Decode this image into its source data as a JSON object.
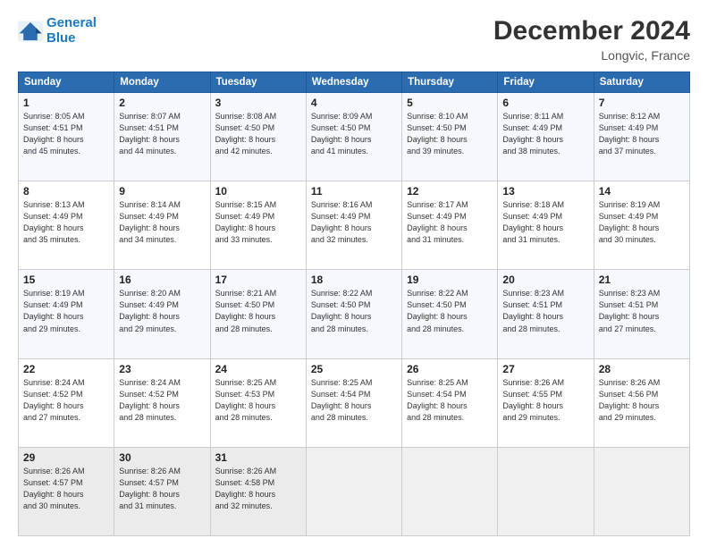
{
  "logo": {
    "line1": "General",
    "line2": "Blue"
  },
  "header": {
    "month": "December 2024",
    "location": "Longvic, France"
  },
  "weekdays": [
    "Sunday",
    "Monday",
    "Tuesday",
    "Wednesday",
    "Thursday",
    "Friday",
    "Saturday"
  ],
  "weeks": [
    [
      {
        "day": "1",
        "lines": [
          "Sunrise: 8:05 AM",
          "Sunset: 4:51 PM",
          "Daylight: 8 hours",
          "and 45 minutes."
        ]
      },
      {
        "day": "2",
        "lines": [
          "Sunrise: 8:07 AM",
          "Sunset: 4:51 PM",
          "Daylight: 8 hours",
          "and 44 minutes."
        ]
      },
      {
        "day": "3",
        "lines": [
          "Sunrise: 8:08 AM",
          "Sunset: 4:50 PM",
          "Daylight: 8 hours",
          "and 42 minutes."
        ]
      },
      {
        "day": "4",
        "lines": [
          "Sunrise: 8:09 AM",
          "Sunset: 4:50 PM",
          "Daylight: 8 hours",
          "and 41 minutes."
        ]
      },
      {
        "day": "5",
        "lines": [
          "Sunrise: 8:10 AM",
          "Sunset: 4:50 PM",
          "Daylight: 8 hours",
          "and 39 minutes."
        ]
      },
      {
        "day": "6",
        "lines": [
          "Sunrise: 8:11 AM",
          "Sunset: 4:49 PM",
          "Daylight: 8 hours",
          "and 38 minutes."
        ]
      },
      {
        "day": "7",
        "lines": [
          "Sunrise: 8:12 AM",
          "Sunset: 4:49 PM",
          "Daylight: 8 hours",
          "and 37 minutes."
        ]
      }
    ],
    [
      {
        "day": "8",
        "lines": [
          "Sunrise: 8:13 AM",
          "Sunset: 4:49 PM",
          "Daylight: 8 hours",
          "and 35 minutes."
        ]
      },
      {
        "day": "9",
        "lines": [
          "Sunrise: 8:14 AM",
          "Sunset: 4:49 PM",
          "Daylight: 8 hours",
          "and 34 minutes."
        ]
      },
      {
        "day": "10",
        "lines": [
          "Sunrise: 8:15 AM",
          "Sunset: 4:49 PM",
          "Daylight: 8 hours",
          "and 33 minutes."
        ]
      },
      {
        "day": "11",
        "lines": [
          "Sunrise: 8:16 AM",
          "Sunset: 4:49 PM",
          "Daylight: 8 hours",
          "and 32 minutes."
        ]
      },
      {
        "day": "12",
        "lines": [
          "Sunrise: 8:17 AM",
          "Sunset: 4:49 PM",
          "Daylight: 8 hours",
          "and 31 minutes."
        ]
      },
      {
        "day": "13",
        "lines": [
          "Sunrise: 8:18 AM",
          "Sunset: 4:49 PM",
          "Daylight: 8 hours",
          "and 31 minutes."
        ]
      },
      {
        "day": "14",
        "lines": [
          "Sunrise: 8:19 AM",
          "Sunset: 4:49 PM",
          "Daylight: 8 hours",
          "and 30 minutes."
        ]
      }
    ],
    [
      {
        "day": "15",
        "lines": [
          "Sunrise: 8:19 AM",
          "Sunset: 4:49 PM",
          "Daylight: 8 hours",
          "and 29 minutes."
        ]
      },
      {
        "day": "16",
        "lines": [
          "Sunrise: 8:20 AM",
          "Sunset: 4:49 PM",
          "Daylight: 8 hours",
          "and 29 minutes."
        ]
      },
      {
        "day": "17",
        "lines": [
          "Sunrise: 8:21 AM",
          "Sunset: 4:50 PM",
          "Daylight: 8 hours",
          "and 28 minutes."
        ]
      },
      {
        "day": "18",
        "lines": [
          "Sunrise: 8:22 AM",
          "Sunset: 4:50 PM",
          "Daylight: 8 hours",
          "and 28 minutes."
        ]
      },
      {
        "day": "19",
        "lines": [
          "Sunrise: 8:22 AM",
          "Sunset: 4:50 PM",
          "Daylight: 8 hours",
          "and 28 minutes."
        ]
      },
      {
        "day": "20",
        "lines": [
          "Sunrise: 8:23 AM",
          "Sunset: 4:51 PM",
          "Daylight: 8 hours",
          "and 28 minutes."
        ]
      },
      {
        "day": "21",
        "lines": [
          "Sunrise: 8:23 AM",
          "Sunset: 4:51 PM",
          "Daylight: 8 hours",
          "and 27 minutes."
        ]
      }
    ],
    [
      {
        "day": "22",
        "lines": [
          "Sunrise: 8:24 AM",
          "Sunset: 4:52 PM",
          "Daylight: 8 hours",
          "and 27 minutes."
        ]
      },
      {
        "day": "23",
        "lines": [
          "Sunrise: 8:24 AM",
          "Sunset: 4:52 PM",
          "Daylight: 8 hours",
          "and 28 minutes."
        ]
      },
      {
        "day": "24",
        "lines": [
          "Sunrise: 8:25 AM",
          "Sunset: 4:53 PM",
          "Daylight: 8 hours",
          "and 28 minutes."
        ]
      },
      {
        "day": "25",
        "lines": [
          "Sunrise: 8:25 AM",
          "Sunset: 4:54 PM",
          "Daylight: 8 hours",
          "and 28 minutes."
        ]
      },
      {
        "day": "26",
        "lines": [
          "Sunrise: 8:25 AM",
          "Sunset: 4:54 PM",
          "Daylight: 8 hours",
          "and 28 minutes."
        ]
      },
      {
        "day": "27",
        "lines": [
          "Sunrise: 8:26 AM",
          "Sunset: 4:55 PM",
          "Daylight: 8 hours",
          "and 29 minutes."
        ]
      },
      {
        "day": "28",
        "lines": [
          "Sunrise: 8:26 AM",
          "Sunset: 4:56 PM",
          "Daylight: 8 hours",
          "and 29 minutes."
        ]
      }
    ],
    [
      {
        "day": "29",
        "lines": [
          "Sunrise: 8:26 AM",
          "Sunset: 4:57 PM",
          "Daylight: 8 hours",
          "and 30 minutes."
        ]
      },
      {
        "day": "30",
        "lines": [
          "Sunrise: 8:26 AM",
          "Sunset: 4:57 PM",
          "Daylight: 8 hours",
          "and 31 minutes."
        ]
      },
      {
        "day": "31",
        "lines": [
          "Sunrise: 8:26 AM",
          "Sunset: 4:58 PM",
          "Daylight: 8 hours",
          "and 32 minutes."
        ]
      },
      null,
      null,
      null,
      null
    ]
  ]
}
